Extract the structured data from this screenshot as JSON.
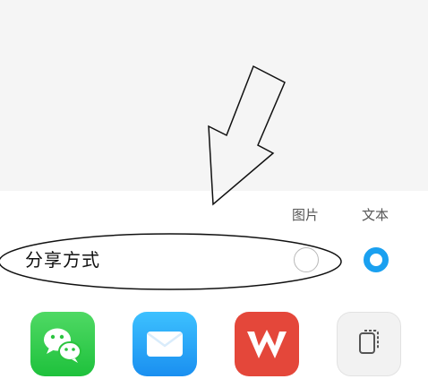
{
  "share_panel": {
    "columns": {
      "image_label": "图片",
      "text_label": "文本"
    },
    "share_method_label": "分享方式",
    "selected_option": "文本"
  },
  "apps": [
    {
      "icon": "wechat-icon",
      "color": "#1ec13c"
    },
    {
      "icon": "mail-icon",
      "color": "#1a8ff0"
    },
    {
      "icon": "wps-icon",
      "color": "#e4473a"
    },
    {
      "icon": "copy-icon",
      "color": "#f2f2f2"
    }
  ],
  "colors": {
    "accent": "#1aa0f0",
    "background": "#f5f5f5",
    "sheet": "#ffffff"
  }
}
